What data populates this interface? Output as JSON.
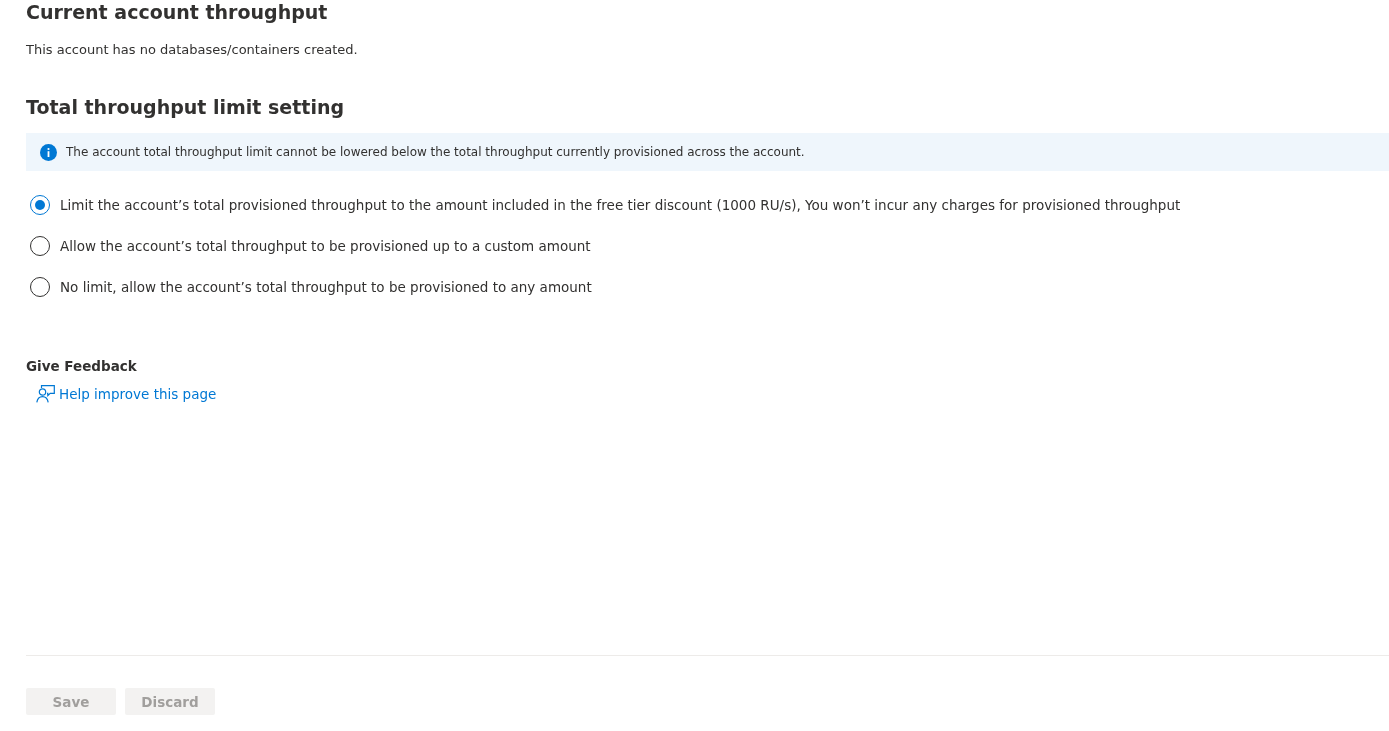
{
  "current_throughput": {
    "title": "Current account throughput",
    "message": "This account has no databases/containers created."
  },
  "limit_setting": {
    "title": "Total throughput limit setting",
    "info": "The account total throughput limit cannot be lowered below the total throughput currently provisioned across the account.",
    "options": [
      {
        "label": "Limit the account’s total provisioned throughput to the amount included in the free tier discount (1000 RU/s), You won’t incur any charges for provisioned throughput",
        "selected": true
      },
      {
        "label": "Allow the account’s total throughput to be provisioned up to a custom amount",
        "selected": false
      },
      {
        "label": "No limit, allow the account’s total throughput to be provisioned to any amount",
        "selected": false
      }
    ]
  },
  "feedback": {
    "title": "Give Feedback",
    "link": "Help improve this page"
  },
  "buttons": [
    {
      "label": "Save",
      "disabled": true
    },
    {
      "label": "Discard",
      "disabled": true
    }
  ]
}
